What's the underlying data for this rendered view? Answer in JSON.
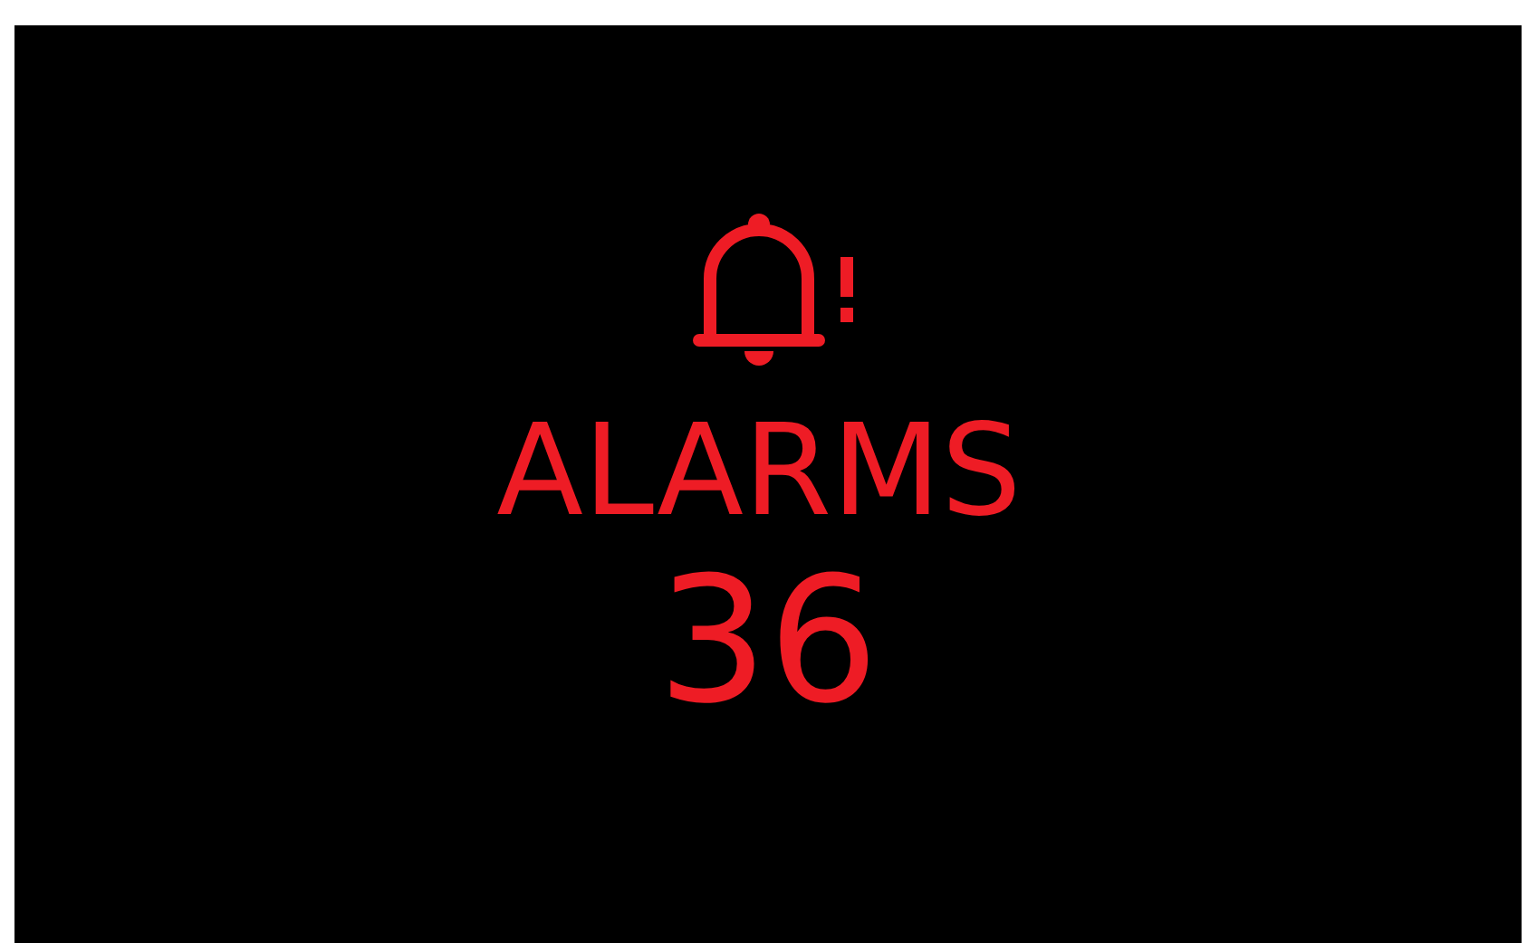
{
  "alarm_panel": {
    "label": "ALARMS",
    "count": "36"
  }
}
